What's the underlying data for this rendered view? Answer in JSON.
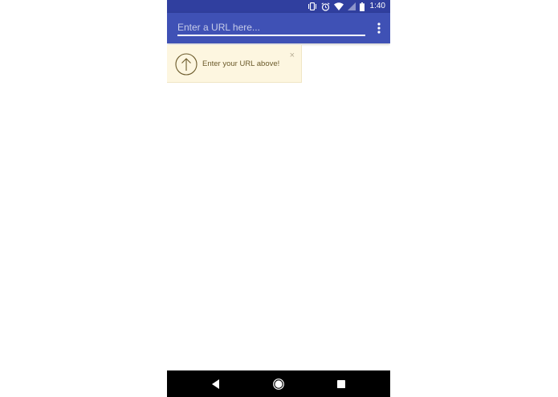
{
  "status_bar": {
    "time": "1:40",
    "icons": [
      "vibrate-icon",
      "alarm-icon",
      "wifi-icon",
      "signal-icon",
      "battery-icon"
    ]
  },
  "app_bar": {
    "url_placeholder": "Enter a URL here...",
    "url_value": "",
    "overflow_icon": "more-vert-icon"
  },
  "hint": {
    "text": "Enter your URL above!",
    "close_label": "×",
    "icon": "arrow-up-circle-icon"
  },
  "nav_bar": {
    "icons": [
      "back-icon",
      "home-icon",
      "recents-icon"
    ]
  },
  "colors": {
    "status_bar": "#303f9f",
    "app_bar": "#3f51b5",
    "hint_bg": "#fdf6e0",
    "hint_text": "#6b5a2a",
    "nav_bar": "#000000"
  }
}
